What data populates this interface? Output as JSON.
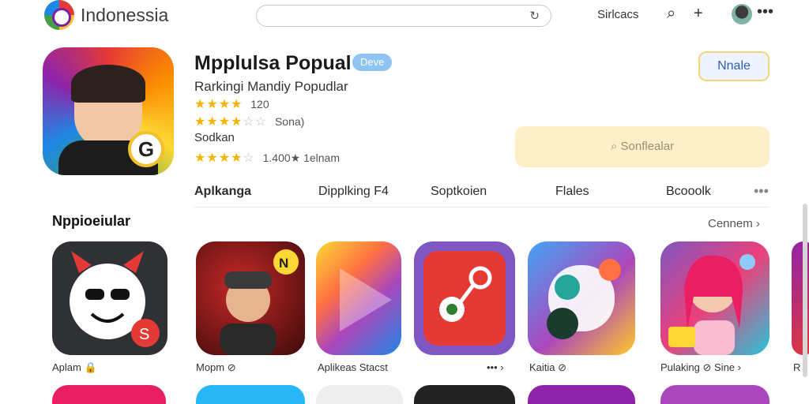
{
  "header": {
    "brand": "Indonessia",
    "search_placeholder": "",
    "link": "Sirlcacs",
    "search_icon": "search-icon",
    "add_icon": "plus-icon",
    "more_icon": "more-dots-icon"
  },
  "hero": {
    "title": "Mpplulsa Popual",
    "badge": "Deve",
    "subtitle": "Rarkingi Mandiy Popudlar",
    "rating1": {
      "stars": "★★★★",
      "text": "120"
    },
    "rating2": {
      "stars": "★★★★",
      "empty": "☆☆",
      "text": "Sona)"
    },
    "developer": "Sodkan",
    "rating3": {
      "stars": "★★★★",
      "empty": "☆",
      "text": "1.400★ 1elnam"
    },
    "install_label": "Nnale",
    "yellow_search_label": "Sonflealar"
  },
  "tabs": [
    {
      "label": "Aplkanga",
      "active": true
    },
    {
      "label": "Dipplking F4",
      "active": false
    },
    {
      "label": "Soptkoien",
      "active": false
    },
    {
      "label": "Flales",
      "active": false
    },
    {
      "label": "Bcooolk",
      "active": false
    }
  ],
  "section": {
    "title": "Nppioeiular",
    "see_more": "Cennem"
  },
  "apps": [
    {
      "label": "Aplam",
      "glyph": "🔒"
    },
    {
      "label": "Mopm",
      "glyph": "⊘"
    },
    {
      "label": "Aplikeas Stacst",
      "glyph": ""
    },
    {
      "label": "Kaitia",
      "glyph": "⊘"
    },
    {
      "label": "Pulaking",
      "glyph": "⊘ Sine"
    },
    {
      "label": "R",
      "glyph": ""
    }
  ],
  "colors": {
    "accent_yellow": "#f4b400",
    "install_border": "#f3d57a",
    "badge_blue": "#8ec3f2"
  }
}
